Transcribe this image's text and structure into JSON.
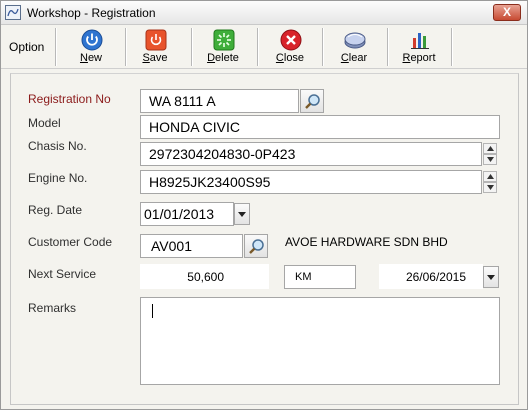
{
  "window": {
    "title": "Workshop - Registration",
    "close_label": "X"
  },
  "toolbar": {
    "option_label": "Option",
    "buttons": [
      {
        "key": "N",
        "rest": "ew",
        "icon": "power-icon"
      },
      {
        "key": "S",
        "rest": "ave",
        "icon": "save-icon"
      },
      {
        "key": "D",
        "rest": "elete",
        "icon": "delete-icon"
      },
      {
        "key": "C",
        "rest": "lose",
        "icon": "close-icon"
      },
      {
        "key": "C",
        "rest": "lear",
        "icon": "clear-icon"
      },
      {
        "key": "R",
        "rest": "eport",
        "icon": "report-icon"
      }
    ]
  },
  "form": {
    "registration_no": {
      "label": "Registration No",
      "value": "WA 8111 A"
    },
    "model": {
      "label": "Model",
      "value": "HONDA CIVIC"
    },
    "chasis_no": {
      "label": "Chasis No.",
      "value": "2972304204830-0P423"
    },
    "engine_no": {
      "label": "Engine No.",
      "value": "H8925JK23400S95"
    },
    "reg_date": {
      "label": "Reg. Date",
      "value": "01/01/2013"
    },
    "customer_code": {
      "label": "Customer Code",
      "value": "AV001",
      "name": "AVOE HARDWARE SDN BHD"
    },
    "next_service": {
      "label": "Next Service",
      "mileage": "50,600",
      "unit": "KM",
      "date": "26/06/2015"
    },
    "remarks": {
      "label": "Remarks",
      "value": ""
    }
  },
  "colors": {
    "required_label": "#8b1a1a",
    "label": "#303030"
  }
}
